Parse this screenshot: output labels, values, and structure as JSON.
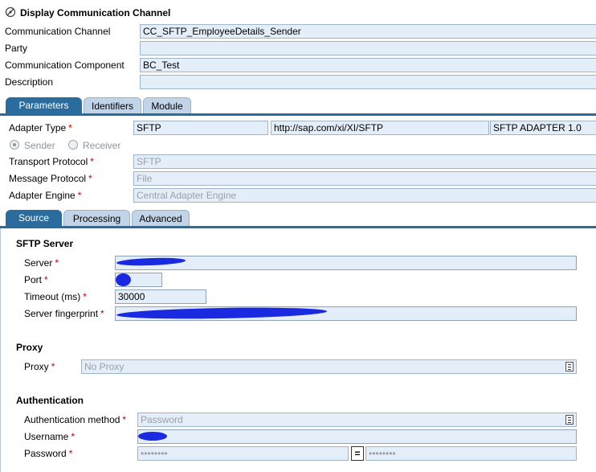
{
  "window": {
    "title": "Display Communication Channel"
  },
  "header": {
    "channel_label": "Communication Channel",
    "channel_value": "CC_SFTP_EmployeeDetails_Sender",
    "party_label": "Party",
    "party_value": "",
    "component_label": "Communication Component",
    "component_value": "BC_Test",
    "description_label": "Description",
    "description_value": ""
  },
  "main_tabs": [
    "Parameters",
    "Identifiers",
    "Module"
  ],
  "adapter": {
    "type_label": "Adapter Type",
    "type_value": "SFTP",
    "namespace": "http://sap.com/xi/XI/SFTP",
    "version": "SFTP ADAPTER 1.0",
    "sender_label": "Sender",
    "receiver_label": "Receiver",
    "transport_label": "Transport Protocol",
    "transport_value": "SFTP",
    "message_label": "Message Protocol",
    "message_value": "File",
    "engine_label": "Adapter Engine",
    "engine_value": "Central Adapter Engine"
  },
  "sub_tabs": [
    "Source",
    "Processing",
    "Advanced"
  ],
  "sftp": {
    "section_title": "SFTP Server",
    "server_label": "Server",
    "port_label": "Port",
    "timeout_label": "Timeout (ms)",
    "timeout_value": "30000",
    "fingerprint_label": "Server fingerprint"
  },
  "proxy": {
    "section_title": "Proxy",
    "proxy_label": "Proxy",
    "proxy_value": "No Proxy"
  },
  "auth": {
    "section_title": "Authentication",
    "method_label": "Authentication method",
    "method_value": "Password",
    "username_label": "Username",
    "password_label": "Password",
    "password_value": "••••••••",
    "password_confirm_value": "••••••••",
    "equals_symbol": "="
  },
  "required_marker": "*",
  "colors": {
    "accent": "#2b6c9e",
    "field_bg": "#e4eef8",
    "required": "#c00000",
    "redaction": "#1a2ae0"
  },
  "icons": [
    "channel-display-icon",
    "dropdown-list-icon"
  ]
}
